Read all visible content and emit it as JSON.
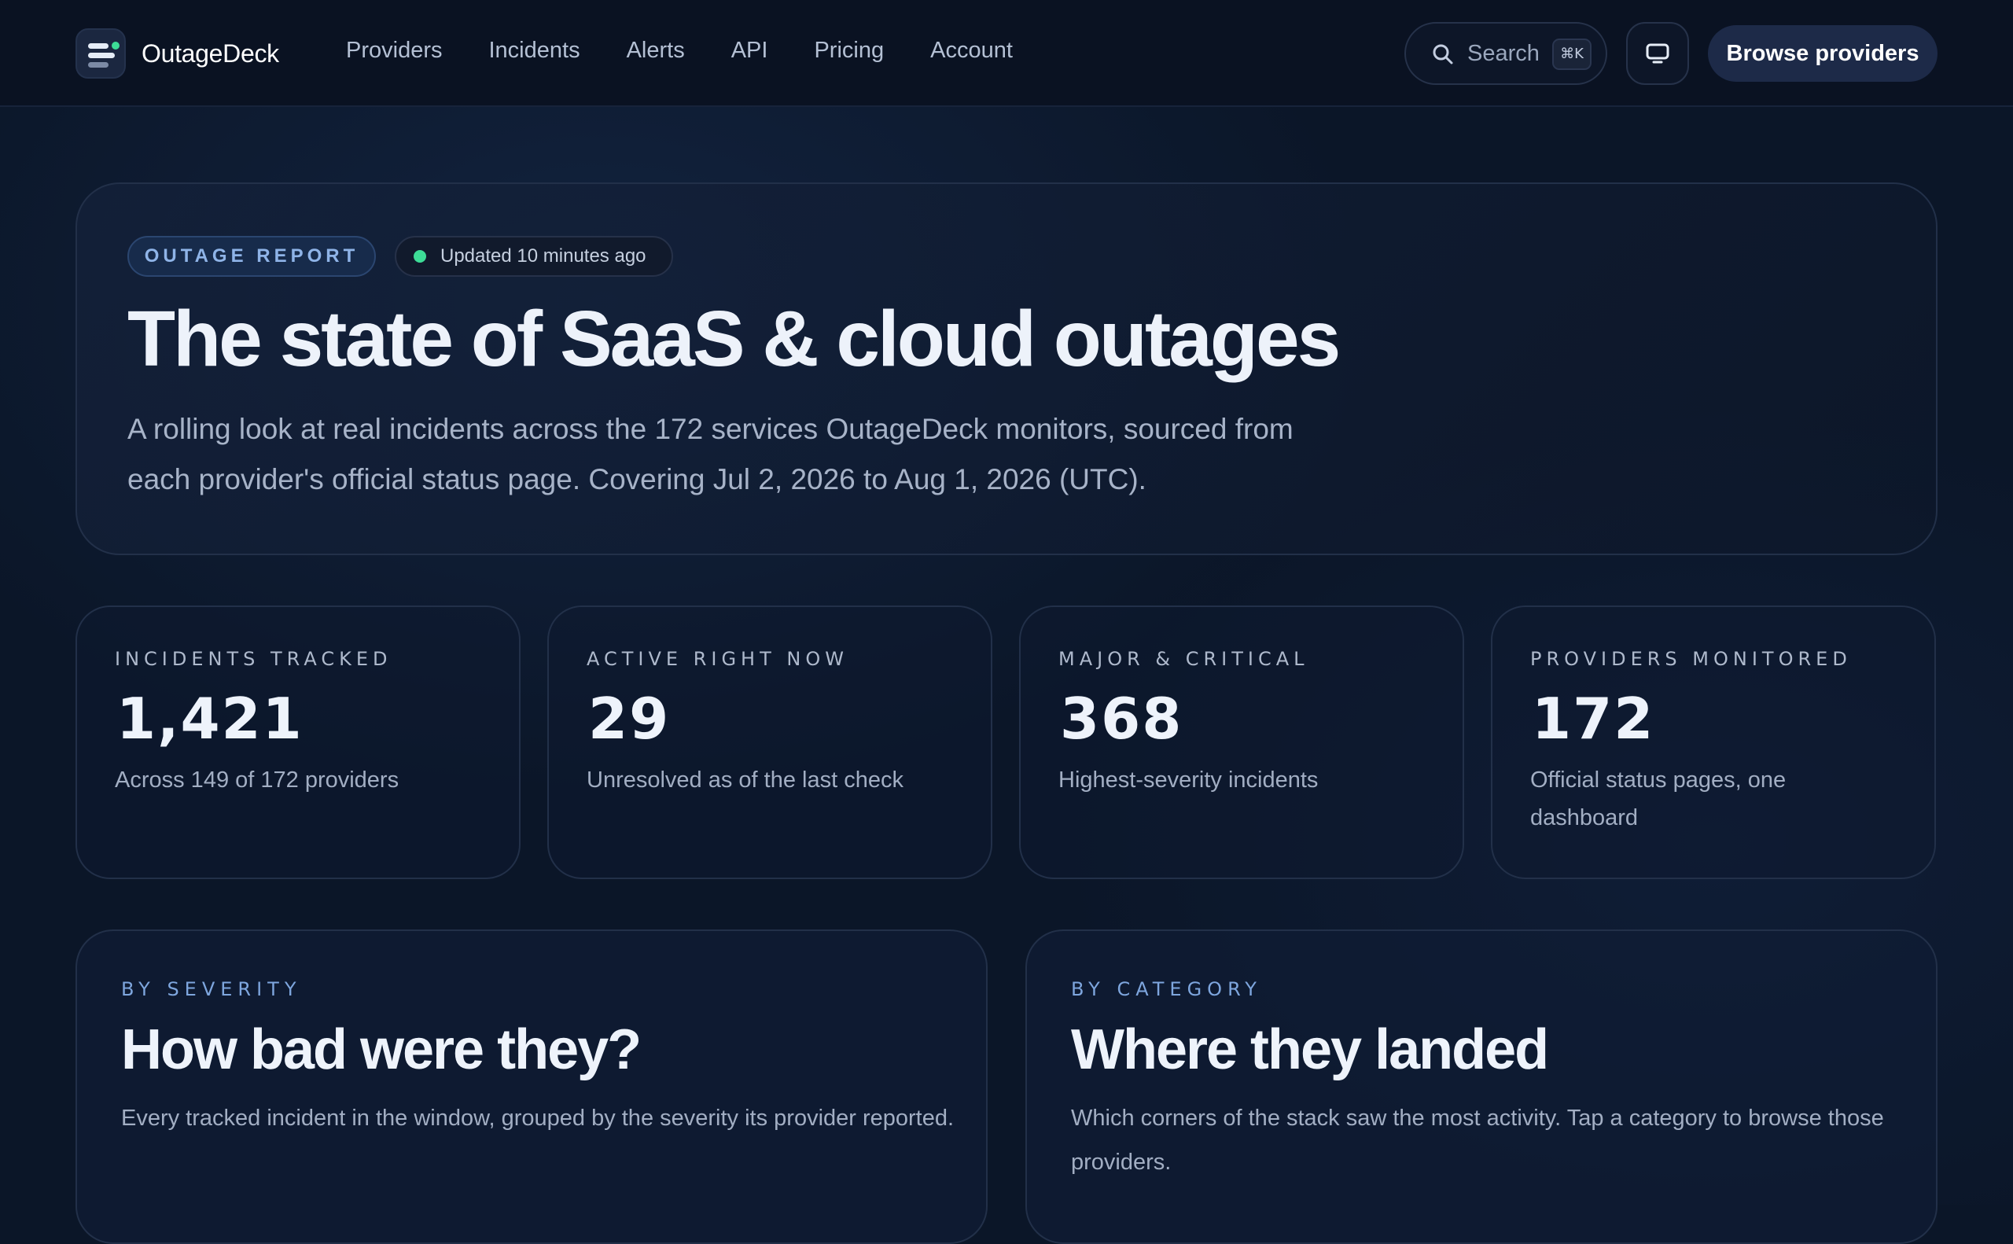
{
  "app": {
    "name": "OutageDeck"
  },
  "nav": {
    "links": [
      "Providers",
      "Incidents",
      "Alerts",
      "API",
      "Pricing",
      "Account"
    ],
    "search_label": "Search",
    "search_shortcut": "⌘K",
    "cta_label": "Browse providers"
  },
  "hero": {
    "badge": "OUTAGE REPORT",
    "updated": "Updated 10 minutes ago",
    "title": "The state of SaaS & cloud outages",
    "description": "A rolling look at real incidents across the 172 services OutageDeck monitors, sourced from each provider's official status page. Covering Jul 2, 2026 to Aug 1, 2026 (UTC)."
  },
  "stats": [
    {
      "label": "INCIDENTS TRACKED",
      "value": "1,421",
      "description": "Across 149 of 172 providers"
    },
    {
      "label": "ACTIVE RIGHT NOW",
      "value": "29",
      "description": "Unresolved as of the last check"
    },
    {
      "label": "MAJOR & CRITICAL",
      "value": "368",
      "description": "Highest-severity incidents"
    },
    {
      "label": "PROVIDERS MONITORED",
      "value": "172",
      "description": "Official status pages, one dashboard"
    }
  ],
  "sections": [
    {
      "kicker": "BY SEVERITY",
      "title": "How bad were they?",
      "description": "Every tracked incident in the window, grouped by the severity its provider reported."
    },
    {
      "kicker": "BY CATEGORY",
      "title": "Where they landed",
      "description": "Which corners of the stack saw the most activity. Tap a category to browse those providers."
    }
  ],
  "colors": {
    "background": "#0b1628",
    "accent_green": "#3ddc97",
    "accent_blue": "#8fb4e8",
    "button": "#1d2a48"
  }
}
